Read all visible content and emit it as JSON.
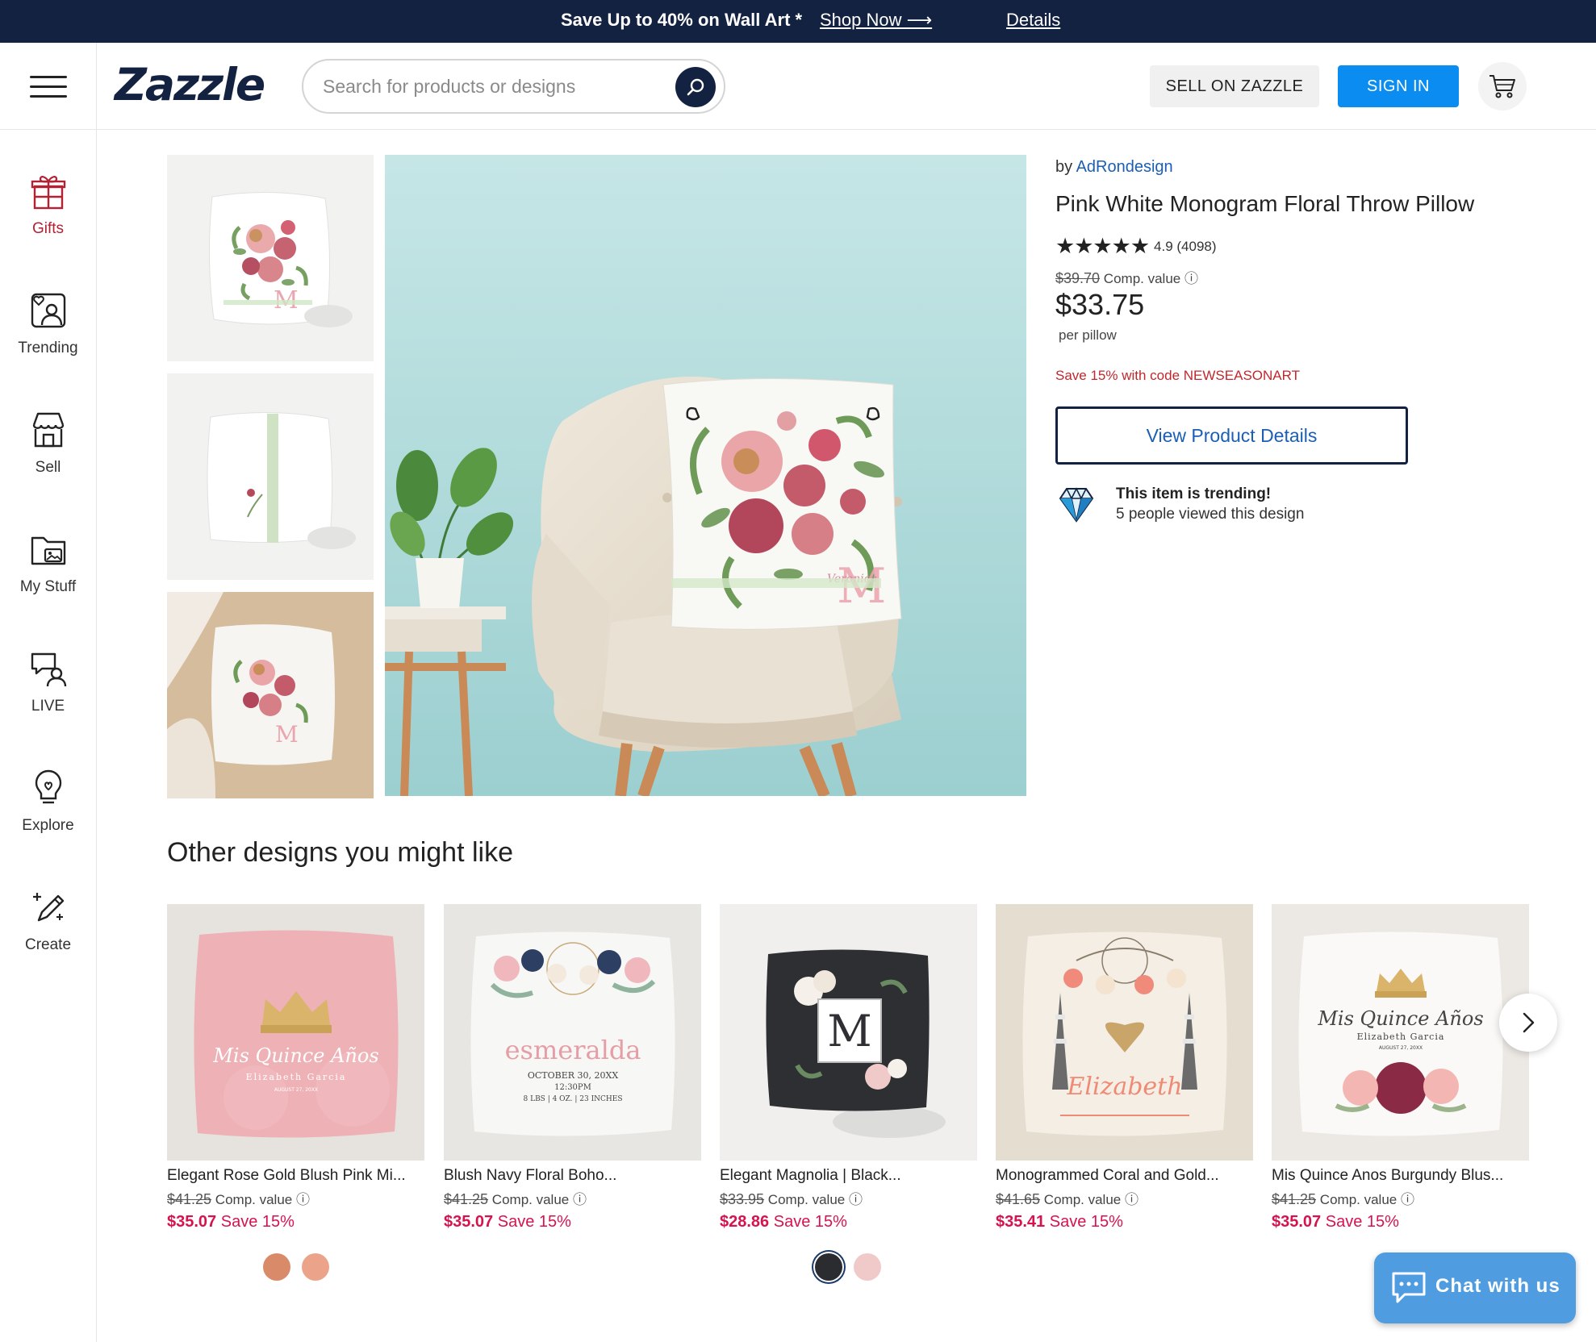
{
  "promo_banner": {
    "message": "Save Up to 40% on Wall Art *",
    "shop_now": "Shop Now ⟶",
    "details": "Details"
  },
  "header": {
    "logo": "Zazzle",
    "search_placeholder": "Search for products or designs",
    "sell_label": "SELL ON ZAZZLE",
    "signin_label": "SIGN IN"
  },
  "sidebar": {
    "items": [
      {
        "label": "Gifts",
        "icon": "gift-icon"
      },
      {
        "label": "Trending",
        "icon": "trending-icon"
      },
      {
        "label": "Sell",
        "icon": "store-icon"
      },
      {
        "label": "My Stuff",
        "icon": "folder-icon"
      },
      {
        "label": "LIVE",
        "icon": "live-chat-icon"
      },
      {
        "label": "Explore",
        "icon": "lightbulb-icon"
      },
      {
        "label": "Create",
        "icon": "magic-pencil-icon"
      }
    ]
  },
  "product": {
    "by_label": "by",
    "designer": "AdRondesign",
    "title": "Pink White Monogram Floral Throw Pillow",
    "stars": "★★★★★",
    "rating": "4.9 (4098)",
    "comp_price": "$39.70",
    "comp_label": "Comp. value ⓘ",
    "price": "$33.75",
    "per": "per pillow",
    "promo_code": "Save 15% with code NEWSEASONART",
    "view_details": "View Product Details",
    "trending_title": "This item is trending!",
    "trending_sub": "5 people viewed this design",
    "main_pillow_name": "Veronica"
  },
  "recommendations": {
    "heading": "Other designs you might like",
    "items": [
      {
        "name": "Elegant Rose Gold Blush Pink Mi...",
        "comp": "$41.25",
        "comp_label": "Comp. value ⓘ",
        "price": "$35.07",
        "save": "Save 15%",
        "art_title": "Mis Quince Años",
        "art_name": "Elizabeth Garcia",
        "art_date": "AUGUST 27, 20XX",
        "swatches": [
          "#d98a68",
          "#eba48a"
        ]
      },
      {
        "name": "Blush Navy Floral Boho...",
        "comp": "$41.25",
        "comp_label": "Comp. value ⓘ",
        "price": "$35.07",
        "save": "Save 15%",
        "art_title": "esmeralda",
        "art_line1": "OCTOBER 30, 20XX",
        "art_line2": "12:30PM",
        "art_line3": "8 LBS | 4 OZ. | 23 INCHES",
        "swatches": []
      },
      {
        "name": "Elegant Magnolia | Black...",
        "comp": "$33.95",
        "comp_label": "Comp. value ⓘ",
        "price": "$28.86",
        "save": "Save 15%",
        "art_title": "M",
        "swatches": [
          "#2a2c30",
          "#f0c9c9"
        ]
      },
      {
        "name": "Monogrammed Coral and Gold...",
        "comp": "$41.65",
        "comp_label": "Comp. value ⓘ",
        "price": "$35.41",
        "save": "Save 15%",
        "art_title": "Elizabeth",
        "swatches": []
      },
      {
        "name": "Mis Quince Anos Burgundy Blus...",
        "comp": "$41.25",
        "comp_label": "Comp. value ⓘ",
        "price": "$35.07",
        "save": "Save 15%",
        "art_title": "Mis Quince Años",
        "art_name": "Elizabeth Garcia",
        "art_date": "AUGUST 27, 20XX",
        "swatches": []
      }
    ]
  },
  "chat": {
    "label": "Chat with us"
  },
  "colors": {
    "navy": "#142241",
    "signin_blue": "#0a8cf0",
    "sale_pink": "#d6134f",
    "promo_red": "#c0282d",
    "chat_blue": "#4f9de0"
  }
}
